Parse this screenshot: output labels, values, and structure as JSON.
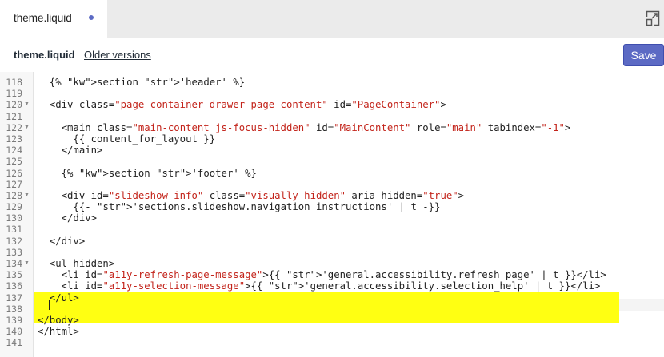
{
  "tab": {
    "label": "theme.liquid",
    "unsaved_indicator": "dot-icon",
    "accent": "#5c6ac4"
  },
  "toolbar": {
    "file_name": "theme.liquid",
    "older_versions_label": "Older versions",
    "save_label": "Save",
    "expand_icon": "expand-icon"
  },
  "editor": {
    "highlight_color": "#ffff00",
    "cursor_line": "138",
    "lines": [
      {
        "n": "118",
        "fold": false,
        "text": "  {% section 'header' %}"
      },
      {
        "n": "119",
        "fold": false,
        "text": ""
      },
      {
        "n": "120",
        "fold": true,
        "text": "  <div class=\"page-container drawer-page-content\" id=\"PageContainer\">"
      },
      {
        "n": "121",
        "fold": false,
        "text": ""
      },
      {
        "n": "122",
        "fold": true,
        "text": "    <main class=\"main-content js-focus-hidden\" id=\"MainContent\" role=\"main\" tabindex=\"-1\">"
      },
      {
        "n": "123",
        "fold": false,
        "text": "      {{ content_for_layout }}"
      },
      {
        "n": "124",
        "fold": false,
        "text": "    </main>"
      },
      {
        "n": "125",
        "fold": false,
        "text": ""
      },
      {
        "n": "126",
        "fold": false,
        "text": "    {% section 'footer' %}"
      },
      {
        "n": "127",
        "fold": false,
        "text": ""
      },
      {
        "n": "128",
        "fold": true,
        "text": "    <div id=\"slideshow-info\" class=\"visually-hidden\" aria-hidden=\"true\">"
      },
      {
        "n": "129",
        "fold": false,
        "text": "      {{- 'sections.slideshow.navigation_instructions' | t -}}"
      },
      {
        "n": "130",
        "fold": false,
        "text": "    </div>"
      },
      {
        "n": "131",
        "fold": false,
        "text": ""
      },
      {
        "n": "132",
        "fold": false,
        "text": "  </div>"
      },
      {
        "n": "133",
        "fold": false,
        "text": ""
      },
      {
        "n": "134",
        "fold": true,
        "text": "  <ul hidden>"
      },
      {
        "n": "135",
        "fold": false,
        "text": "    <li id=\"a11y-refresh-page-message\">{{ 'general.accessibility.refresh_page' | t }}</li>"
      },
      {
        "n": "136",
        "fold": false,
        "text": "    <li id=\"a11y-selection-message\">{{ 'general.accessibility.selection_help' | t }}</li>"
      },
      {
        "n": "137",
        "fold": false,
        "text": "  </ul>"
      },
      {
        "n": "138",
        "fold": false,
        "text": ""
      },
      {
        "n": "139",
        "fold": false,
        "text": "</body>"
      },
      {
        "n": "140",
        "fold": false,
        "text": "</html>"
      },
      {
        "n": "141",
        "fold": false,
        "text": ""
      }
    ]
  }
}
